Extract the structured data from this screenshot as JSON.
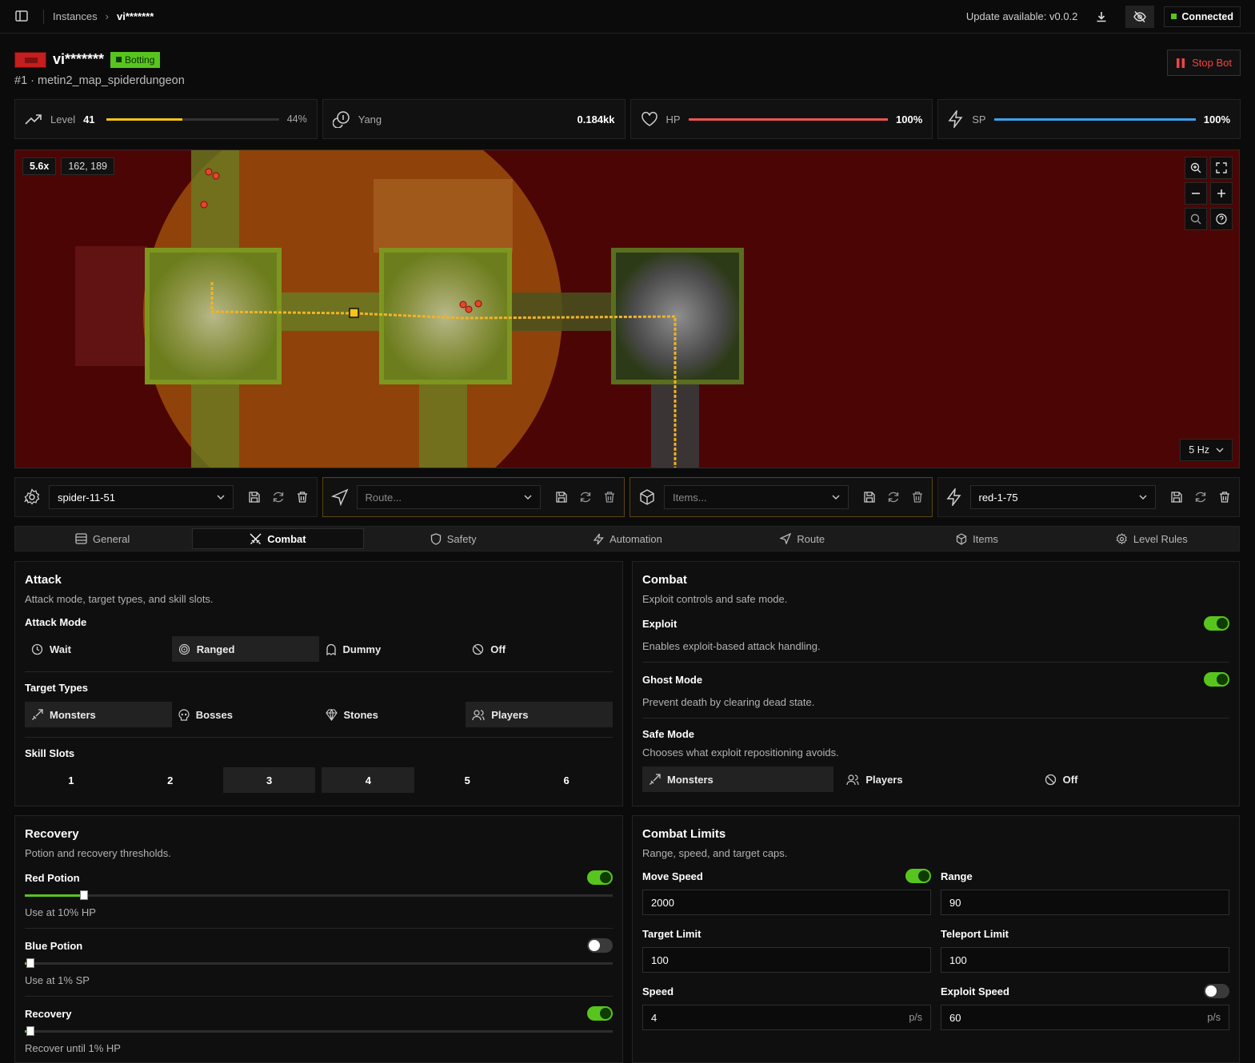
{
  "breadcrumb": {
    "parent": "Instances",
    "current": "vi*******"
  },
  "topbar": {
    "update_text": "Update available: v0.0.2",
    "status": "Connected"
  },
  "instance": {
    "name": "vi*******",
    "state": "Botting",
    "subtitle": "#1 · metin2_map_spiderdungeon",
    "stop_label": "Stop Bot"
  },
  "stats": {
    "level": {
      "label": "Level",
      "value": "41",
      "progress_text": "44%",
      "progress": 0.44
    },
    "yang": {
      "label": "Yang",
      "value": "0.184kk"
    },
    "hp": {
      "label": "HP",
      "value": "100%",
      "progress": 1.0
    },
    "sp": {
      "label": "SP",
      "value": "100%",
      "progress": 1.0
    }
  },
  "map": {
    "zoom": "5.6x",
    "coords": "162, 189",
    "rate": "5 Hz"
  },
  "configs": {
    "general": {
      "value": "spider-11-51"
    },
    "route": {
      "placeholder": "Route..."
    },
    "items": {
      "placeholder": "Items..."
    },
    "level": {
      "value": "red-1-75"
    }
  },
  "tabs": [
    {
      "label": "General"
    },
    {
      "label": "Combat"
    },
    {
      "label": "Safety"
    },
    {
      "label": "Automation"
    },
    {
      "label": "Route"
    },
    {
      "label": "Items"
    },
    {
      "label": "Level Rules"
    }
  ],
  "attack": {
    "title": "Attack",
    "desc": "Attack mode, target types, and skill slots.",
    "mode_label": "Attack Mode",
    "modes": [
      "Wait",
      "Ranged",
      "Dummy",
      "Off"
    ],
    "targets_label": "Target Types",
    "targets": [
      "Monsters",
      "Bosses",
      "Stones",
      "Players"
    ],
    "skills_label": "Skill Slots",
    "skills": [
      "1",
      "2",
      "3",
      "4",
      "5",
      "6"
    ]
  },
  "combat": {
    "title": "Combat",
    "desc": "Exploit controls and safe mode.",
    "exploit_label": "Exploit",
    "exploit_desc": "Enables exploit-based attack handling.",
    "ghost_label": "Ghost Mode",
    "ghost_desc": "Prevent death by clearing dead state.",
    "safe_label": "Safe Mode",
    "safe_desc": "Chooses what exploit repositioning avoids.",
    "safe_options": [
      "Monsters",
      "Players",
      "Off"
    ]
  },
  "recovery": {
    "title": "Recovery",
    "desc": "Potion and recovery thresholds.",
    "red_label": "Red Potion",
    "red_text": "Use at 10% HP",
    "red_value": 0.1,
    "blue_label": "Blue Potion",
    "blue_text": "Use at 1% SP",
    "blue_value": 0.01,
    "rec_label": "Recovery",
    "rec_text": "Recover until 1% HP",
    "rec_value": 0.01
  },
  "limits": {
    "title": "Combat Limits",
    "desc": "Range, speed, and target caps.",
    "move_speed_label": "Move Speed",
    "move_speed": "2000",
    "range_label": "Range",
    "range": "90",
    "target_limit_label": "Target Limit",
    "target_limit": "100",
    "teleport_limit_label": "Teleport Limit",
    "teleport_limit": "100",
    "speed_label": "Speed",
    "speed": "4",
    "speed_unit": "p/s",
    "exploit_speed_label": "Exploit Speed",
    "exploit_speed": "60",
    "exploit_speed_unit": "p/s"
  },
  "colors": {
    "accent": "#57c51e",
    "hp": "#ef5350",
    "sp": "#3ba4ee",
    "level": "#f5c518",
    "danger": "#ef4444"
  }
}
